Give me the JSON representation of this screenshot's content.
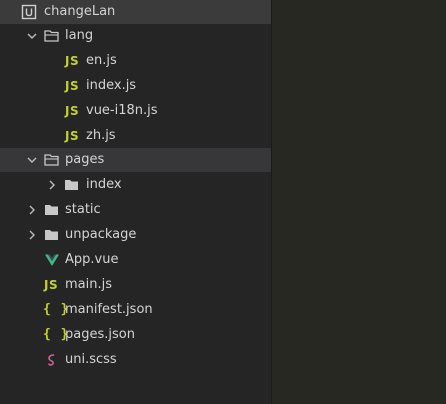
{
  "project": {
    "name": "changeLan",
    "icon": "project-box-icon"
  },
  "tree": {
    "lang_folder": "lang",
    "lang_files": [
      "en.js",
      "index.js",
      "vue-i18n.js",
      "zh.js"
    ],
    "pages_folder": "pages",
    "pages_index_folder": "index",
    "static_folder": "static",
    "unpackage_folder": "unpackage",
    "app_vue": "App.vue",
    "main_js": "main.js",
    "manifest_json": "manifest.json",
    "pages_json": "pages.json",
    "uni_scss": "uni.scss"
  },
  "icons": {
    "js_badge": "JS",
    "json_badge": "{ }"
  },
  "colors": {
    "tree_bg": "#252525",
    "highlight": "#37373a",
    "js_accent": "#c4d12a",
    "vue_green": "#41b883",
    "scss_pink": "#cd6799",
    "text": "#d4d4d4"
  }
}
